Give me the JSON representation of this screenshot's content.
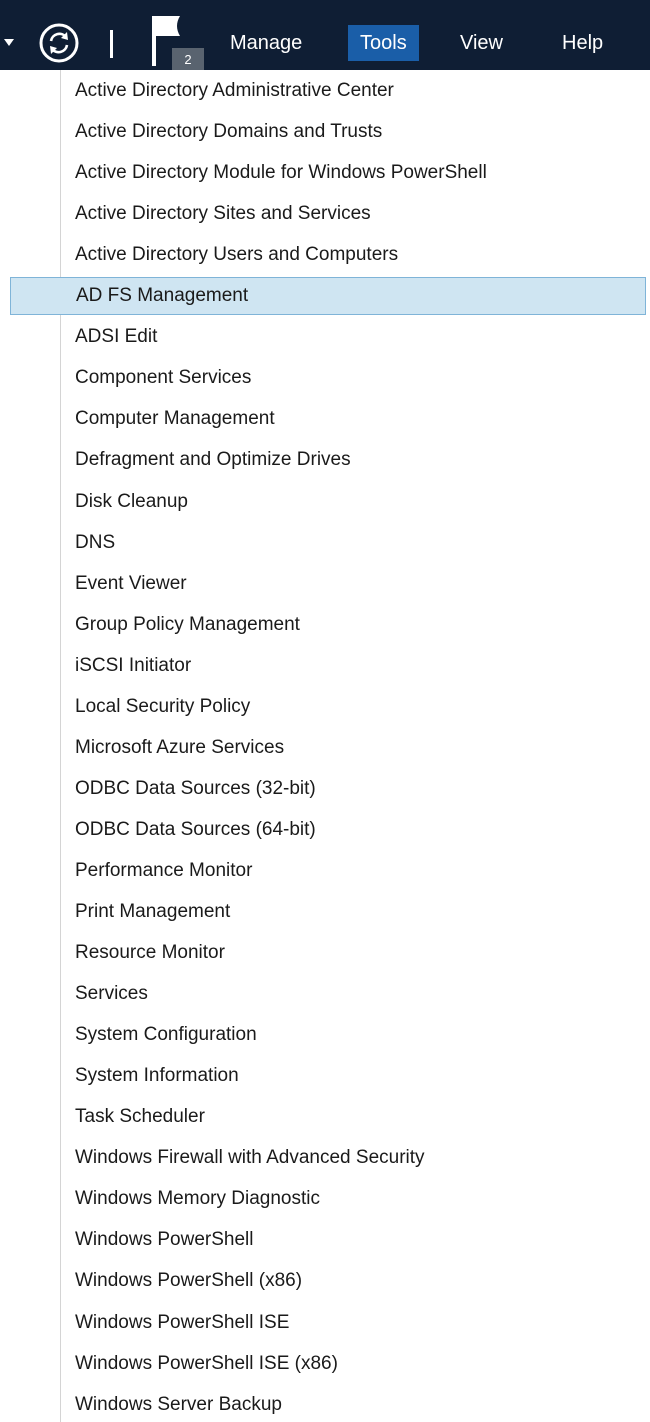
{
  "menubar": {
    "notification_count": "2",
    "items": [
      {
        "label": "Manage",
        "active": false
      },
      {
        "label": "Tools",
        "active": true
      },
      {
        "label": "View",
        "active": false
      },
      {
        "label": "Help",
        "active": false
      }
    ],
    "icons": {
      "dropdown": "caret-down-icon",
      "refresh": "refresh-icon",
      "notifications": "flag-icon"
    },
    "colors": {
      "bar_background": "#0f1e34",
      "active_menu_background": "#1a5ea8",
      "hover_item_background": "#cfe5f2",
      "hover_item_border": "#7fb4d8"
    }
  },
  "tools_menu": {
    "highlighted_index": 5,
    "items": [
      "Active Directory Administrative Center",
      "Active Directory Domains and Trusts",
      "Active Directory Module for Windows PowerShell",
      "Active Directory Sites and Services",
      "Active Directory Users and Computers",
      "AD FS Management",
      "ADSI Edit",
      "Component Services",
      "Computer Management",
      "Defragment and Optimize Drives",
      "Disk Cleanup",
      "DNS",
      "Event Viewer",
      "Group Policy Management",
      "iSCSI Initiator",
      "Local Security Policy",
      "Microsoft Azure Services",
      "ODBC Data Sources (32-bit)",
      "ODBC Data Sources (64-bit)",
      "Performance Monitor",
      "Print Management",
      "Resource Monitor",
      "Services",
      "System Configuration",
      "System Information",
      "Task Scheduler",
      "Windows Firewall with Advanced Security",
      "Windows Memory Diagnostic",
      "Windows PowerShell",
      "Windows PowerShell (x86)",
      "Windows PowerShell ISE",
      "Windows PowerShell ISE (x86)",
      "Windows Server Backup"
    ]
  }
}
